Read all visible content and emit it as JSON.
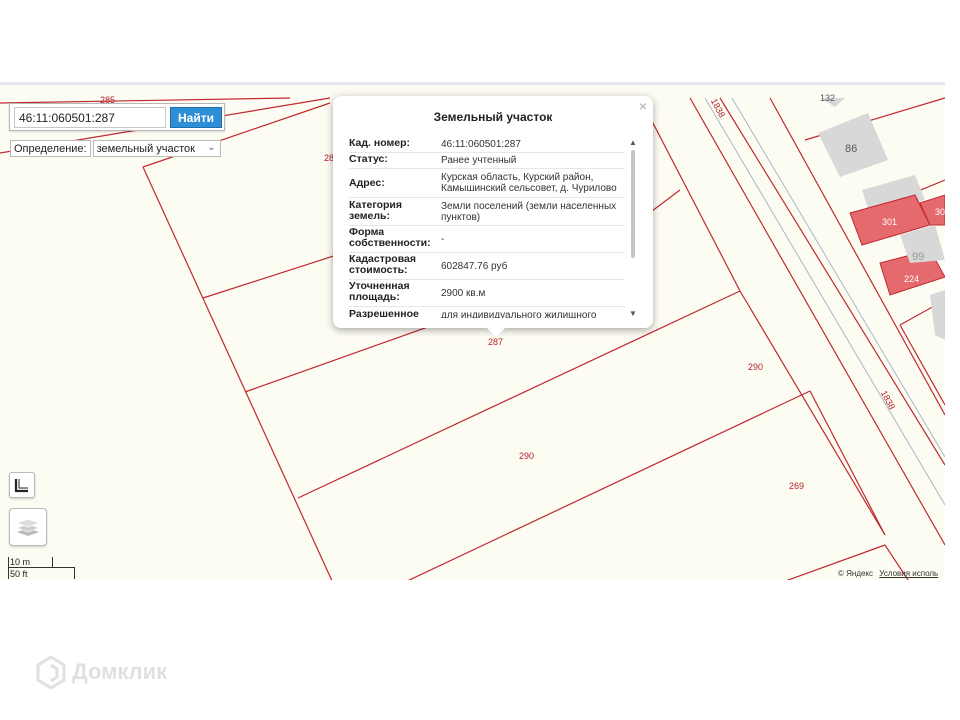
{
  "search": {
    "value": "46:11:060501:287",
    "button": "Найти"
  },
  "definition": {
    "label": "Определение:",
    "selected": "земельный участок"
  },
  "popup": {
    "title": "Земельный участок",
    "close": "×",
    "props": [
      {
        "key": "Кад. номер:",
        "value": "46:11:060501:287"
      },
      {
        "key": "Статус:",
        "value": "Ранее учтенный"
      },
      {
        "key": "Адрес:",
        "value": "Курская область, Курский район, Камышинский сельсовет, д. Чурилово"
      },
      {
        "key": "Категория земель:",
        "value": "Земли поселений (земли населенных пунктов)"
      },
      {
        "key": "Форма собственности:",
        "value": "-"
      },
      {
        "key": "Кадастровая стоимость:",
        "value": "602847.76 руб"
      },
      {
        "key": "Уточненная площадь:",
        "value": "2900 кв.м"
      },
      {
        "key": "Разрешенное",
        "value": "для индивидуального жилищного"
      }
    ]
  },
  "map": {
    "plot_labels": [
      "285",
      "28",
      "287",
      "290",
      "290",
      "269",
      "1838",
      "1838",
      "132",
      "30"
    ],
    "house_numbers": [
      "86",
      "301",
      "224",
      "99"
    ],
    "colors": {
      "boundary": "#c0282f",
      "building_red": "#e46a6e",
      "building_gray": "#d8d8d8",
      "map_bg": "#fdfcf3",
      "button_blue": "#2f8fd6"
    }
  },
  "scale": {
    "meters": "10 m",
    "feet": "50 ft"
  },
  "copyright": {
    "text": "© Яндекс",
    "link": "Условия исполь"
  },
  "watermark": {
    "text": "Домклик"
  }
}
